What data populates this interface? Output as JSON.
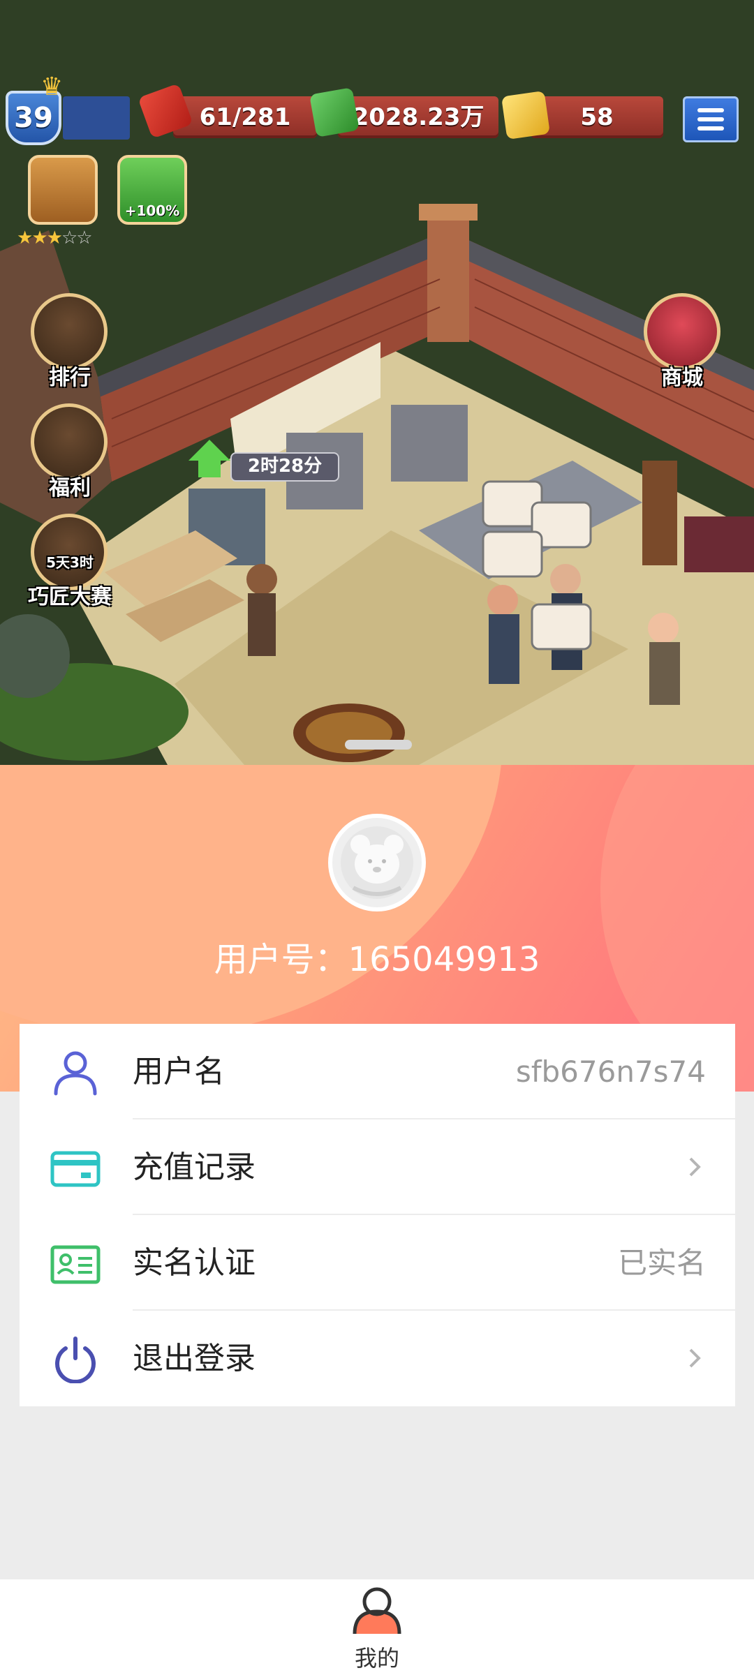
{
  "game": {
    "level": "39",
    "energy": "61/281",
    "cash": "2028.23万",
    "gold": "58",
    "stars_filled": 3,
    "stars_total": 5,
    "side_buttons": [
      {
        "label": "排行"
      },
      {
        "label": "福利"
      },
      {
        "label": "巧匠大赛",
        "badge": "5天3时"
      }
    ],
    "bonus_badge": "+100%",
    "shop_label": "商城",
    "upgrade_timer": "2时28分"
  },
  "profile": {
    "user_id_label": "用户号：165049913"
  },
  "menu": [
    {
      "label": "用户名",
      "value": "sfb676n7s74",
      "icon": "user-icon",
      "color": "#5a62d6"
    },
    {
      "label": "充值记录",
      "value": "",
      "icon": "card-icon",
      "color": "#2ec4c4"
    },
    {
      "label": "实名认证",
      "value": "已实名",
      "icon": "id-card-icon",
      "color": "#3fbf6a"
    },
    {
      "label": "退出登录",
      "value": "",
      "icon": "power-icon",
      "color": "#4a4fb0"
    }
  ],
  "tabbar": {
    "tabs": [
      {
        "label": "我的",
        "icon": "profile-tab-icon"
      }
    ]
  }
}
